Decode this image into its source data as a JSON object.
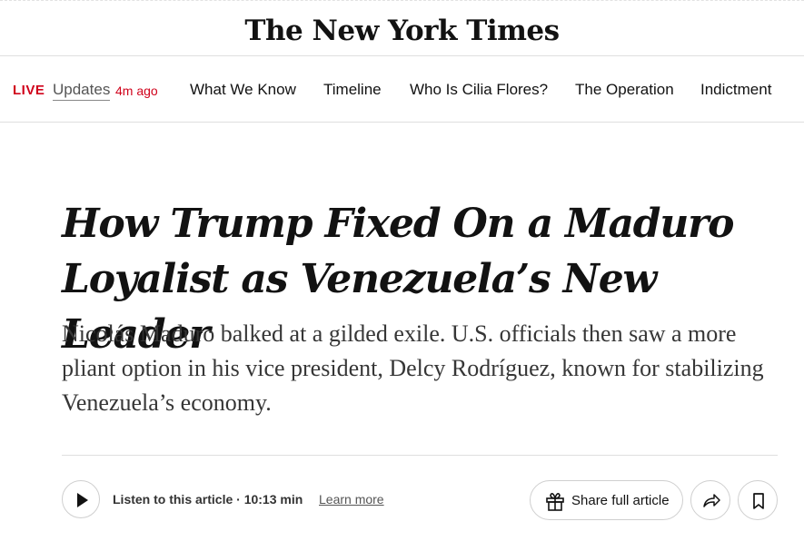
{
  "masthead": {
    "title": "The New York Times"
  },
  "nav": {
    "live": "LIVE",
    "updates": "Updates",
    "time_ago": "4m ago",
    "links": [
      "What We Know",
      "Timeline",
      "Who Is Cilia Flores?",
      "The Operation",
      "Indictment"
    ]
  },
  "article": {
    "headline": "How Trump Fixed On a Maduro Loyalist as Venezuela’s New Leader",
    "summary": "Nicolás Maduro balked at a gilded exile. U.S. officials then saw a more pliant option in his vice president, Delcy Rodríguez, known for stabilizing Venezuela’s economy."
  },
  "audio": {
    "listen_text": "Listen to this article · 10:13 min",
    "learn_more": "Learn more"
  },
  "actions": {
    "share_full_article": "Share full article"
  },
  "icons": {
    "play": "play-icon",
    "gift": "gift-icon",
    "share": "share-arrow-icon",
    "bookmark": "bookmark-icon"
  },
  "colors": {
    "live_red": "#d0021b",
    "text": "#121212",
    "border": "#dfdfdf"
  }
}
